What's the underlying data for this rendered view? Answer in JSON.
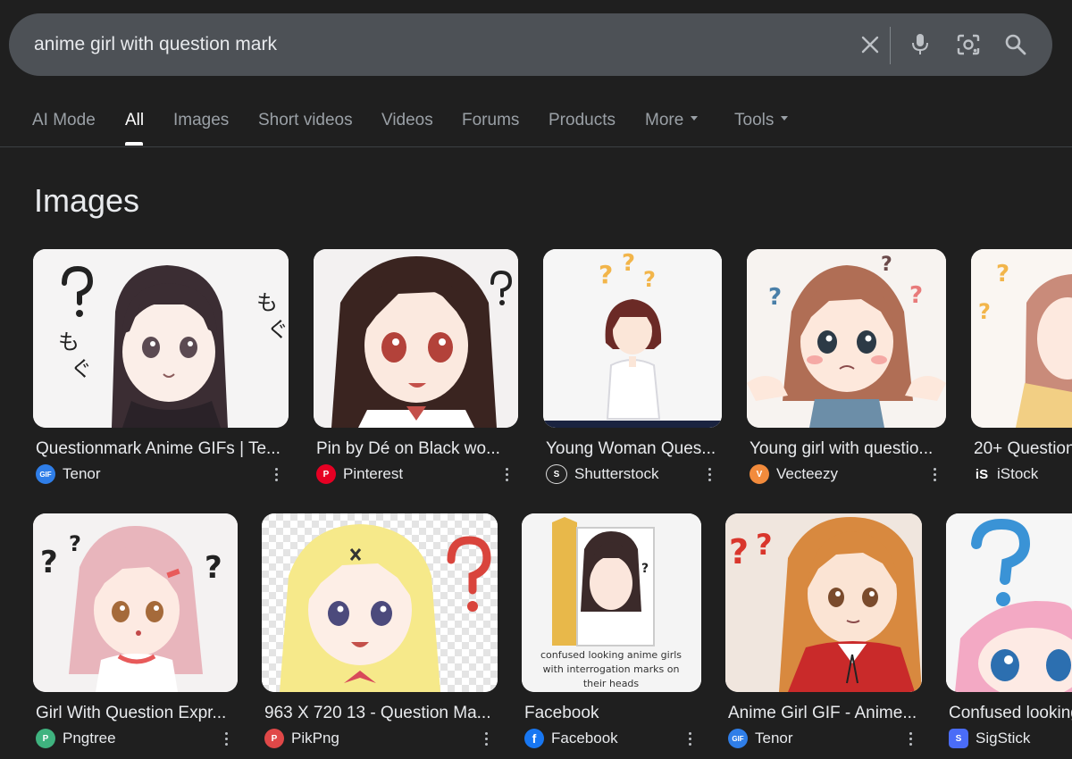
{
  "search": {
    "query": "anime girl with question mark",
    "clear_icon": "close-icon",
    "voice_icon": "microphone-icon",
    "lens_icon": "camera-lens-icon",
    "search_icon": "search-icon"
  },
  "tabs": [
    {
      "label": "AI Mode"
    },
    {
      "label": "All",
      "active": true
    },
    {
      "label": "Images"
    },
    {
      "label": "Short videos"
    },
    {
      "label": "Videos"
    },
    {
      "label": "Forums"
    },
    {
      "label": "Products"
    },
    {
      "label": "More"
    },
    {
      "label": "Tools"
    }
  ],
  "section_title": "Images",
  "results": [
    {
      "title": "Questionmark Anime GIFs | Te...",
      "source": "Tenor",
      "favicon": "GIF",
      "favicon_color": "#2f7ee8"
    },
    {
      "title": "Pin by Dé on Black wo...",
      "source": "Pinterest",
      "favicon": "P",
      "favicon_color": "#e60023"
    },
    {
      "title": "Young Woman Ques...",
      "source": "Shutterstock",
      "favicon": "S",
      "favicon_color": "#222222"
    },
    {
      "title": "Young girl with questio...",
      "source": "Vecteezy",
      "favicon": "V",
      "favicon_color": "#f28b3c"
    },
    {
      "title": "20+ Question",
      "source": "iStock",
      "favicon": "iS",
      "favicon_color": "#1f1f1f"
    },
    {
      "title": "Girl With Question Expr...",
      "source": "Pngtree",
      "favicon": "P",
      "favicon_color": "#3fb37f"
    },
    {
      "title": "963 X 720 13 - Question Ma...",
      "source": "PikPng",
      "favicon": "P",
      "favicon_color": "#e04848"
    },
    {
      "title": "Facebook",
      "source": "Facebook",
      "favicon": "f",
      "favicon_color": "#1877f2"
    },
    {
      "title": "Anime Girl GIF - Anime...",
      "source": "Tenor",
      "favicon": "GIF",
      "favicon_color": "#2f7ee8"
    },
    {
      "title": "Confused looking",
      "source": "SigStick",
      "favicon": "S",
      "favicon_color": "#4a6cf7"
    }
  ],
  "thumb_text": {
    "moguu": "もぐ",
    "facebook_caption_1": "confused looking anime girls",
    "facebook_caption_2": "with interrogation marks on",
    "facebook_caption_3": "their heads"
  }
}
